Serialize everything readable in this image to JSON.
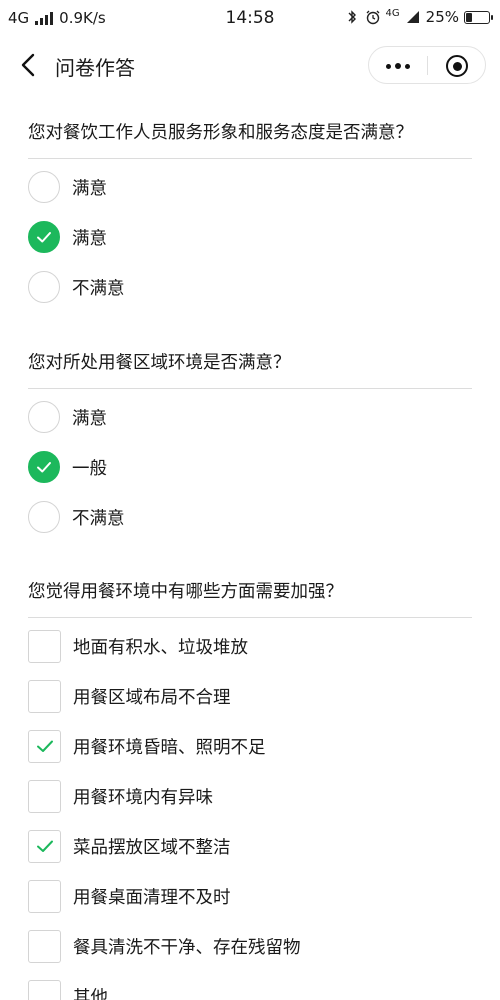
{
  "status_bar": {
    "network": "4G",
    "speed": "0.9K/s",
    "time": "14:58",
    "net_small": "4G",
    "battery": "25%",
    "battery_level": 0.25
  },
  "nav": {
    "title": "问卷作答"
  },
  "colors": {
    "accent": "#1cb85c",
    "border": "#d4d4d4",
    "text": "#1a1a1a"
  },
  "questions": [
    {
      "title": "您对餐饮工作人员服务形象和服务态度是否满意？",
      "type": "radio",
      "options": [
        {
          "label": "满意",
          "selected": false
        },
        {
          "label": "满意",
          "selected": true
        },
        {
          "label": "不满意",
          "selected": false
        }
      ]
    },
    {
      "title": "您对所处用餐区域环境是否满意？",
      "type": "radio",
      "options": [
        {
          "label": "满意",
          "selected": false
        },
        {
          "label": "一般",
          "selected": true
        },
        {
          "label": "不满意",
          "selected": false
        }
      ]
    },
    {
      "title": "您觉得用餐环境中有哪些方面需要加强？",
      "type": "checkbox",
      "options": [
        {
          "label": "地面有积水、垃圾堆放",
          "selected": false
        },
        {
          "label": "用餐区域布局不合理",
          "selected": false
        },
        {
          "label": "用餐环境昏暗、照明不足",
          "selected": true
        },
        {
          "label": "用餐环境内有异味",
          "selected": false
        },
        {
          "label": "菜品摆放区域不整洁",
          "selected": true
        },
        {
          "label": "用餐桌面清理不及时",
          "selected": false
        },
        {
          "label": "餐具清洗不干净、存在残留物",
          "selected": false
        },
        {
          "label": "其他",
          "selected": false
        }
      ]
    }
  ]
}
